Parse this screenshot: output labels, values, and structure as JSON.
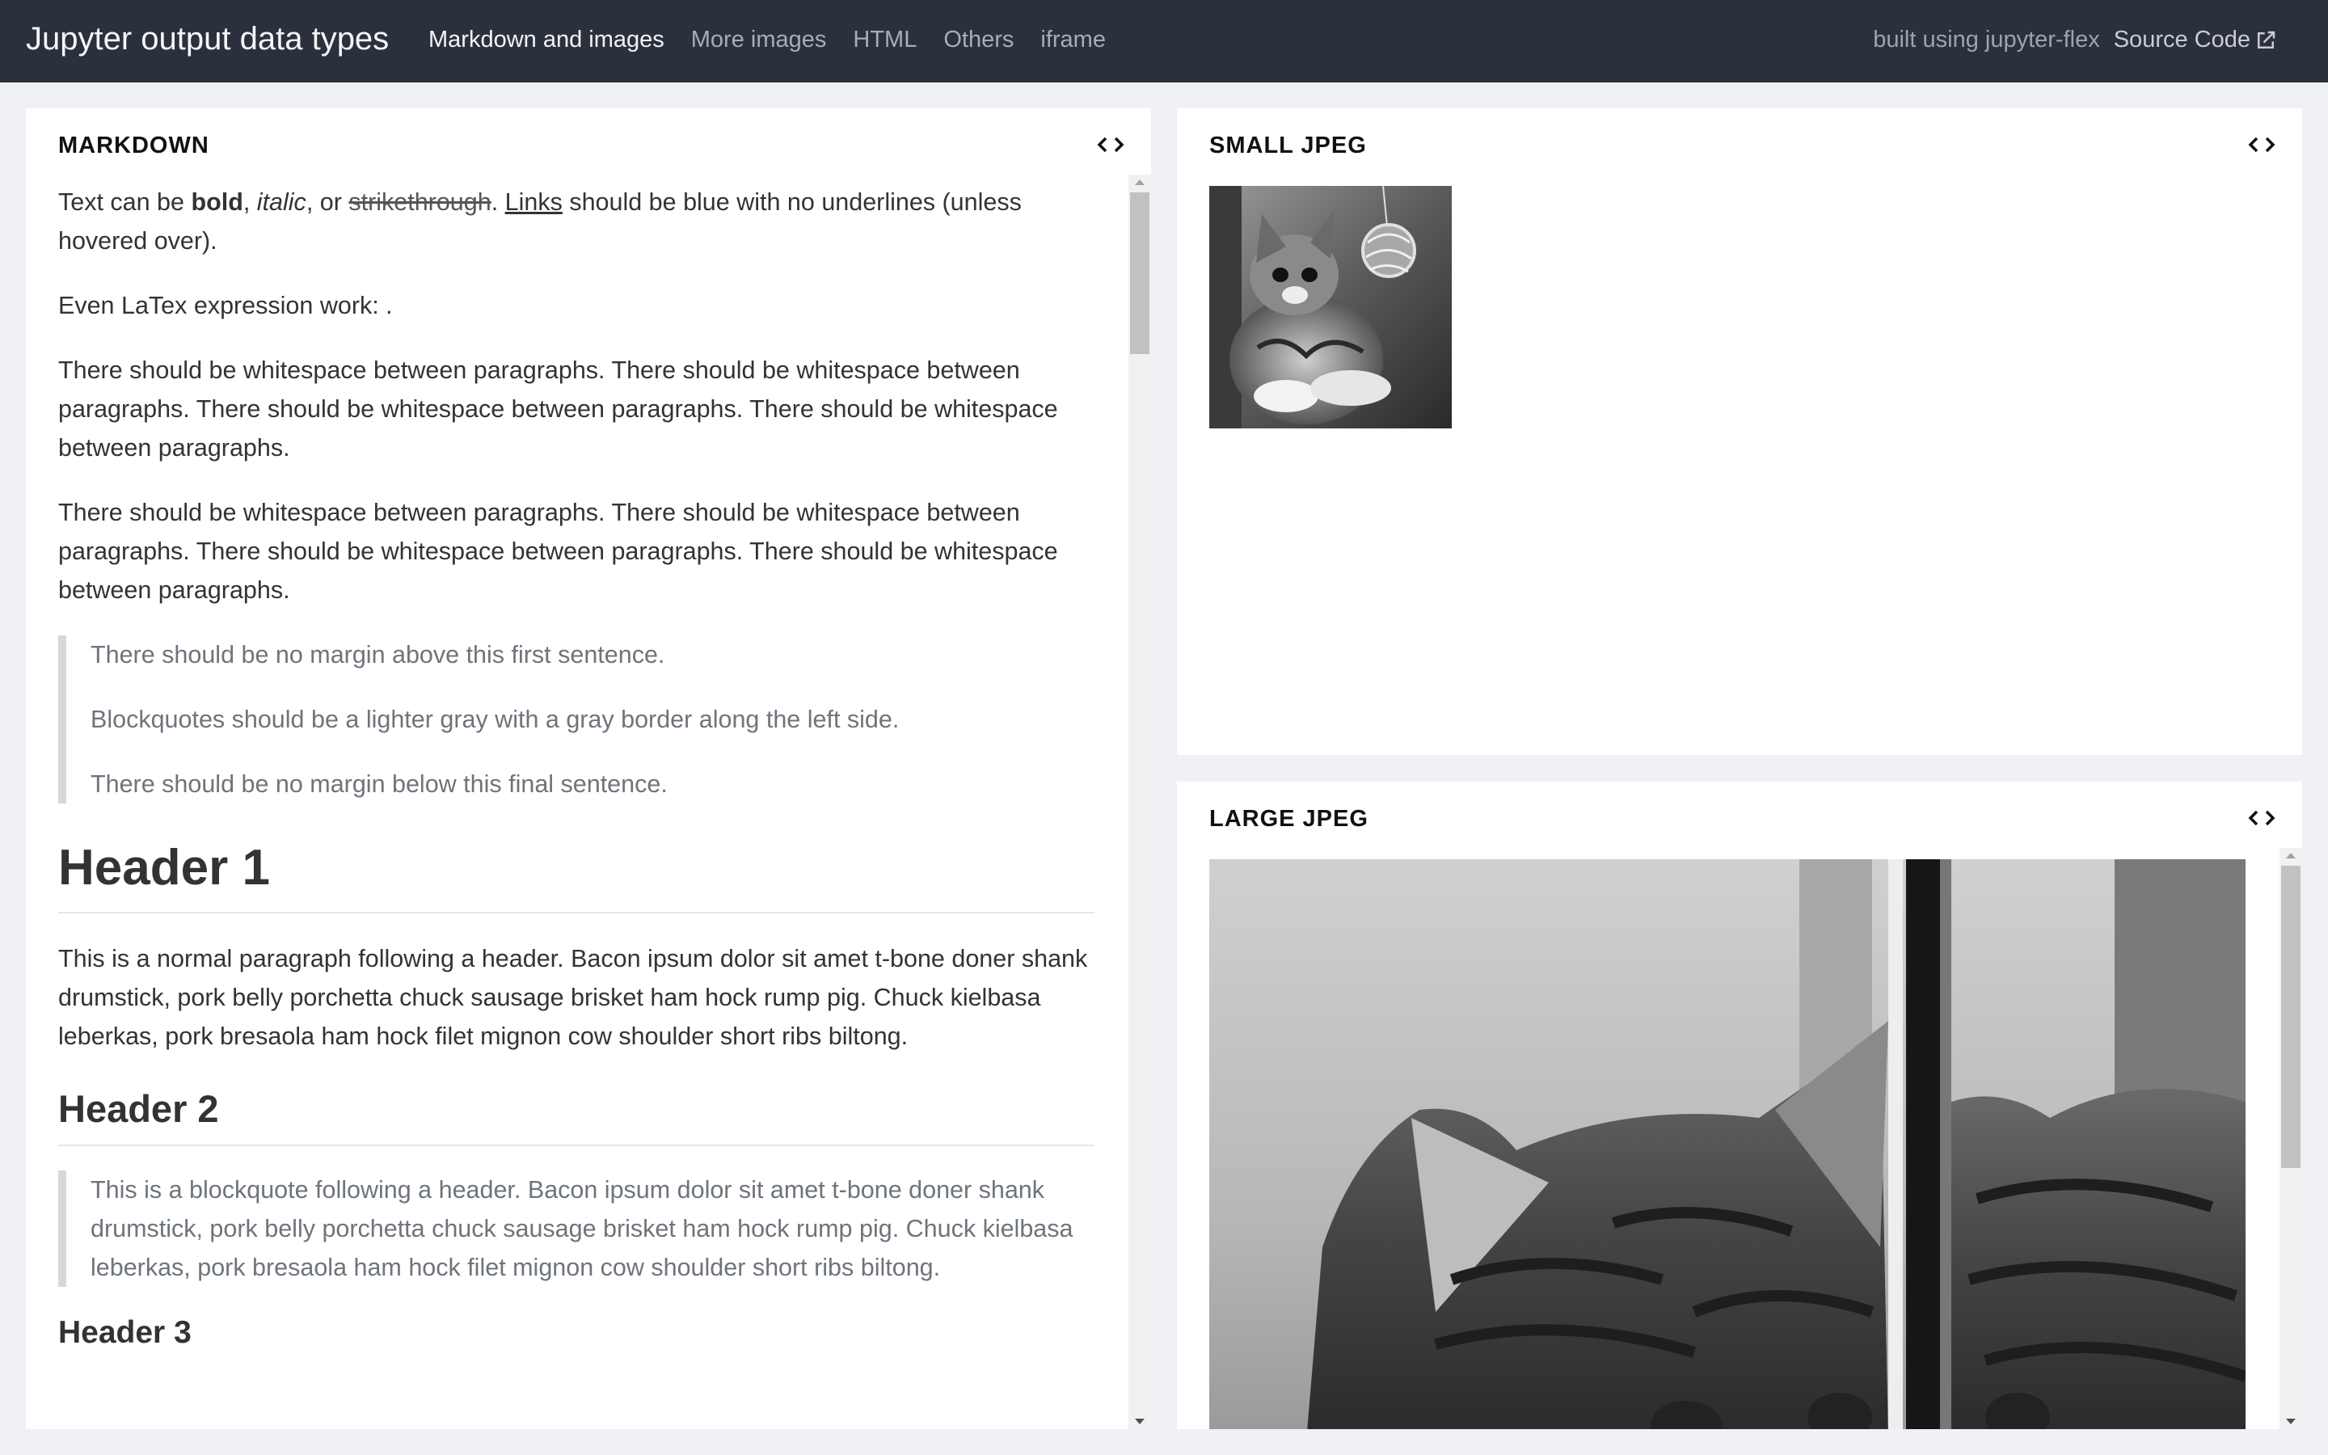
{
  "app": {
    "title": "Jupyter output data types"
  },
  "nav": {
    "tabs": [
      "Markdown and images",
      "More images",
      "HTML",
      "Others",
      "iframe"
    ],
    "built_text": "built using jupyter-flex",
    "source_label": "Source Code"
  },
  "markdown_card": {
    "title": "MARKDOWN",
    "p1": {
      "pre": "Text can be ",
      "bold": "bold",
      "sep1": ", ",
      "italic": "italic",
      "sep2": ", or ",
      "strike": "strikethrough",
      "sep3": ". ",
      "link": "Links",
      "post": " should be blue with no underlines (unless hovered over)."
    },
    "p2": "Even LaTex expression work: .",
    "p3": "There should be whitespace between paragraphs. There should be whitespace between paragraphs. There should be whitespace between paragraphs. There should be whitespace between paragraphs.",
    "p4": "There should be whitespace between paragraphs. There should be whitespace between paragraphs. There should be whitespace between paragraphs. There should be whitespace between paragraphs.",
    "bq1": [
      "There should be no margin above this first sentence.",
      "Blockquotes should be a lighter gray with a gray border along the left side.",
      "There should be no margin below this final sentence."
    ],
    "h1": "Header 1",
    "p5": "This is a normal paragraph following a header. Bacon ipsum dolor sit amet t-bone doner shank drumstick, pork belly porchetta chuck sausage brisket ham hock rump pig. Chuck kielbasa leberkas, pork bresaola ham hock filet mignon cow shoulder short ribs biltong.",
    "h2": "Header 2",
    "bq2": "This is a blockquote following a header. Bacon ipsum dolor sit amet t-bone doner shank drumstick, pork belly porchetta chuck sausage brisket ham hock rump pig. Chuck kielbasa leberkas, pork bresaola ham hock filet mignon cow shoulder short ribs biltong.",
    "h3": "Header 3"
  },
  "small_card": {
    "title": "SMALL JPEG"
  },
  "large_card": {
    "title": "LARGE JPEG"
  },
  "icons": {
    "code": "code-brackets-icon",
    "external": "external-link-icon"
  }
}
